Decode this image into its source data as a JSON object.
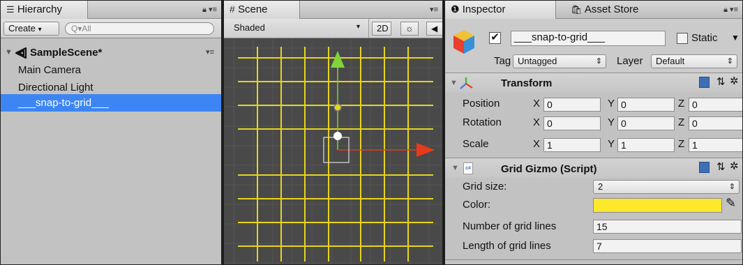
{
  "hierarchy": {
    "tab_label": "Hierarchy",
    "create_label": "Create",
    "search_placeholder": "All",
    "scene_name": "SampleScene*",
    "items": [
      {
        "label": "Main Camera"
      },
      {
        "label": "Directional Light"
      },
      {
        "label": "___snap-to-grid___"
      }
    ]
  },
  "scene": {
    "tab_label": "Scene",
    "shading_mode": "Shaded",
    "mode_2d_label": "2D",
    "colors": {
      "grid": "#e6d51e",
      "background": "#494949",
      "y_axis": "#7fd43a",
      "x_axis": "#e83a1a"
    }
  },
  "inspector": {
    "tab_label": "Inspector",
    "asset_store_tab_label": "Asset Store",
    "object_name": "___snap-to-grid___",
    "active": true,
    "static_label": "Static",
    "static_checked": false,
    "tag_label": "Tag",
    "tag_value": "Untagged",
    "layer_label": "Layer",
    "layer_value": "Default",
    "transform": {
      "title": "Transform",
      "rows": [
        {
          "label": "Position",
          "x": "0",
          "y": "0",
          "z": "0"
        },
        {
          "label": "Rotation",
          "x": "0",
          "y": "0",
          "z": "0"
        },
        {
          "label": "Scale",
          "x": "1",
          "y": "1",
          "z": "1"
        }
      ],
      "axis_labels": {
        "x": "X",
        "y": "Y",
        "z": "Z"
      }
    },
    "grid_gizmo": {
      "title": "Grid Gizmo (Script)",
      "grid_size_label": "Grid size:",
      "grid_size_value": "2",
      "color_label": "Color:",
      "color_value": "#fde82c",
      "num_lines_label": "Number of grid lines",
      "num_lines_value": "15",
      "length_label": "Length of grid lines",
      "length_value": "7"
    }
  }
}
